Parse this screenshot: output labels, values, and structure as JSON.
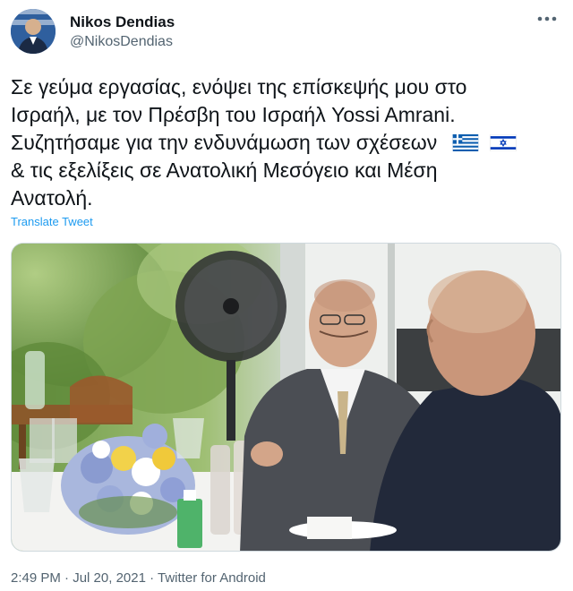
{
  "author": {
    "name": "Nikos Dendias",
    "handle": "@NikosDendias"
  },
  "tweet": {
    "line1": "Σε γεύμα εργασίας, ενόψει της επίσκεψής μου στο",
    "line2": "Ισραήλ, με τον Πρέσβη του Ισραήλ Yossi Amrani.",
    "line3": "Συζητήσαμε για την ενδυνάμωση των σχέσεων",
    "line4": "& τις εξελίξεις σε Ανατολική Μεσόγειο και Μέση",
    "line5": "Ανατολή.",
    "flags": [
      "greece-flag",
      "israel-flag"
    ]
  },
  "translate_label": "Translate Tweet",
  "meta": {
    "time": "2:49 PM",
    "separator1": " · ",
    "date": "Jul 20, 2021",
    "separator2": " · ",
    "app": "Twitter for Android"
  },
  "colors": {
    "link": "#1d9bf0",
    "secondary_text": "#536471",
    "greek_blue": "#0d5eaf",
    "israel_blue": "#0038b8"
  },
  "icons": [
    "more-options-icon"
  ]
}
